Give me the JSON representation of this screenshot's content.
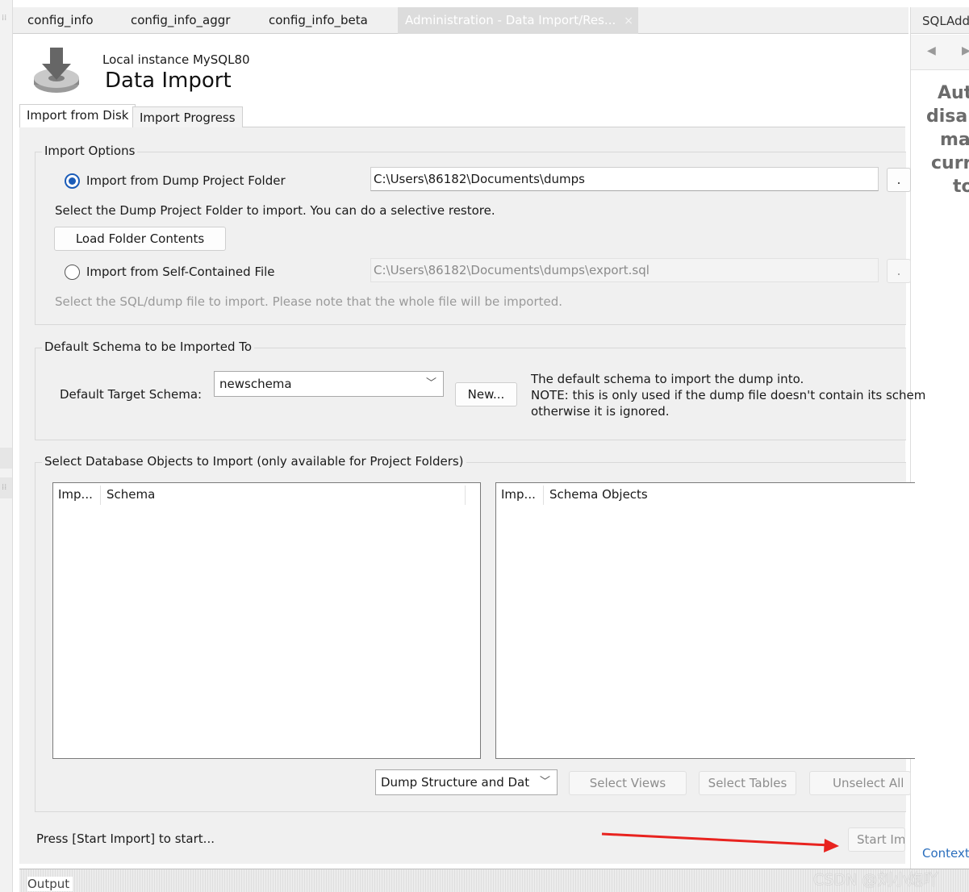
{
  "tabs": [
    {
      "label": "config_info",
      "active": false
    },
    {
      "label": "config_info_aggr",
      "active": false
    },
    {
      "label": "config_info_beta",
      "active": false
    },
    {
      "label": "Administration - Data Import/Res...",
      "active": true
    }
  ],
  "tab_close": "×",
  "right_panel": {
    "title": "SQLAdd",
    "help_lines": [
      "Aut",
      "disal",
      "ma",
      "curr",
      "to"
    ],
    "context_link": "Context"
  },
  "header": {
    "instance": "Local instance MySQL80",
    "title": "Data Import",
    "icon": "download-disk-icon"
  },
  "page_tabs": [
    {
      "label": "Import from Disk",
      "active": true
    },
    {
      "label": "Import Progress",
      "active": false
    }
  ],
  "import_options": {
    "title": "Import Options",
    "dump_folder": {
      "label": "Import from Dump Project Folder",
      "checked": true,
      "path": "C:\\Users\\86182\\Documents\\dumps",
      "browse": ".",
      "hint": "Select the Dump Project Folder to import. You can do a selective restore.",
      "load_button": "Load Folder Contents"
    },
    "self_contained": {
      "label": "Import from Self-Contained File",
      "checked": false,
      "path": "C:\\Users\\86182\\Documents\\dumps\\export.sql",
      "browse": ".",
      "hint": "Select the SQL/dump file to import. Please note that the whole file will be imported."
    }
  },
  "default_schema": {
    "title": "Default Schema to be Imported To",
    "label": "Default Target Schema:",
    "selected": "newschema",
    "new_button": "New...",
    "note_lines": [
      "The default schema to import the dump into.",
      "NOTE: this is only used if the dump file doesn't contain its schem",
      "otherwise it is ignored."
    ]
  },
  "objects": {
    "title": "Select Database Objects to Import (only available for Project Folders)",
    "left_columns": [
      "Imp...",
      "Schema"
    ],
    "right_columns": [
      "Imp...",
      "Schema Objects"
    ],
    "dump_select": "Dump Structure and Dat",
    "buttons": [
      "Select Views",
      "Select Tables",
      "Unselect All"
    ]
  },
  "status": "Press [Start Import] to start...",
  "start_button": "Start Im",
  "output": {
    "label": "Output"
  },
  "watermark": "CSDN @刘小炮吖",
  "colors": {
    "accent": "#1b5cb8",
    "annotation": "#e8231f",
    "link": "#2a6ebd"
  }
}
